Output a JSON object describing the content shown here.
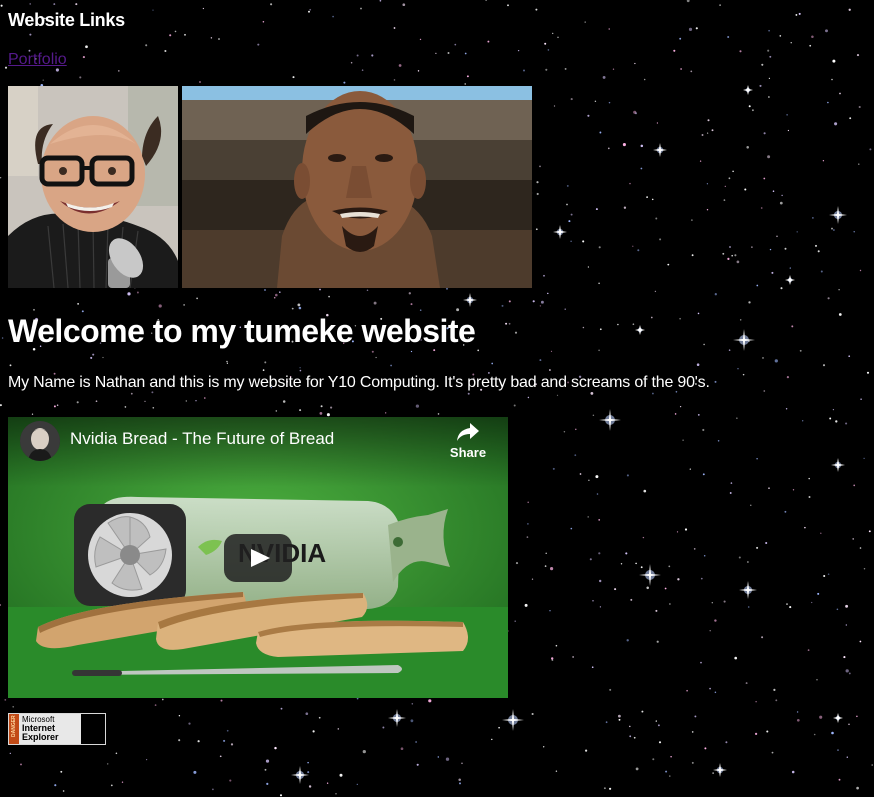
{
  "header": {
    "links_heading": "Website Links",
    "portfolio_link": "Portfolio"
  },
  "images": [
    {
      "name": "portrait-bald-man-glasses"
    },
    {
      "name": "game-character-screenshot"
    }
  ],
  "main": {
    "title": "Welcome to my tumeke website",
    "intro": "My Name is Nathan and this is my website for Y10 Computing. It's pretty bad and screams of the 90's."
  },
  "video": {
    "title": "Nvidia Bread - The Future of Bread",
    "share_label": "Share",
    "product_text": "NVIDIA",
    "icons": {
      "share": "share-arrow-icon",
      "play": "play-icon",
      "avatar": "channel-avatar"
    }
  },
  "badge": {
    "strip_text": "DANGER",
    "line1": "Microsoft",
    "line2": "Internet",
    "line3": "Explorer"
  },
  "colors": {
    "background": "#000000",
    "text": "#ffffff",
    "visited_link": "#551a8b",
    "video_green": "#2f8a2f",
    "play_button": "#212121"
  }
}
